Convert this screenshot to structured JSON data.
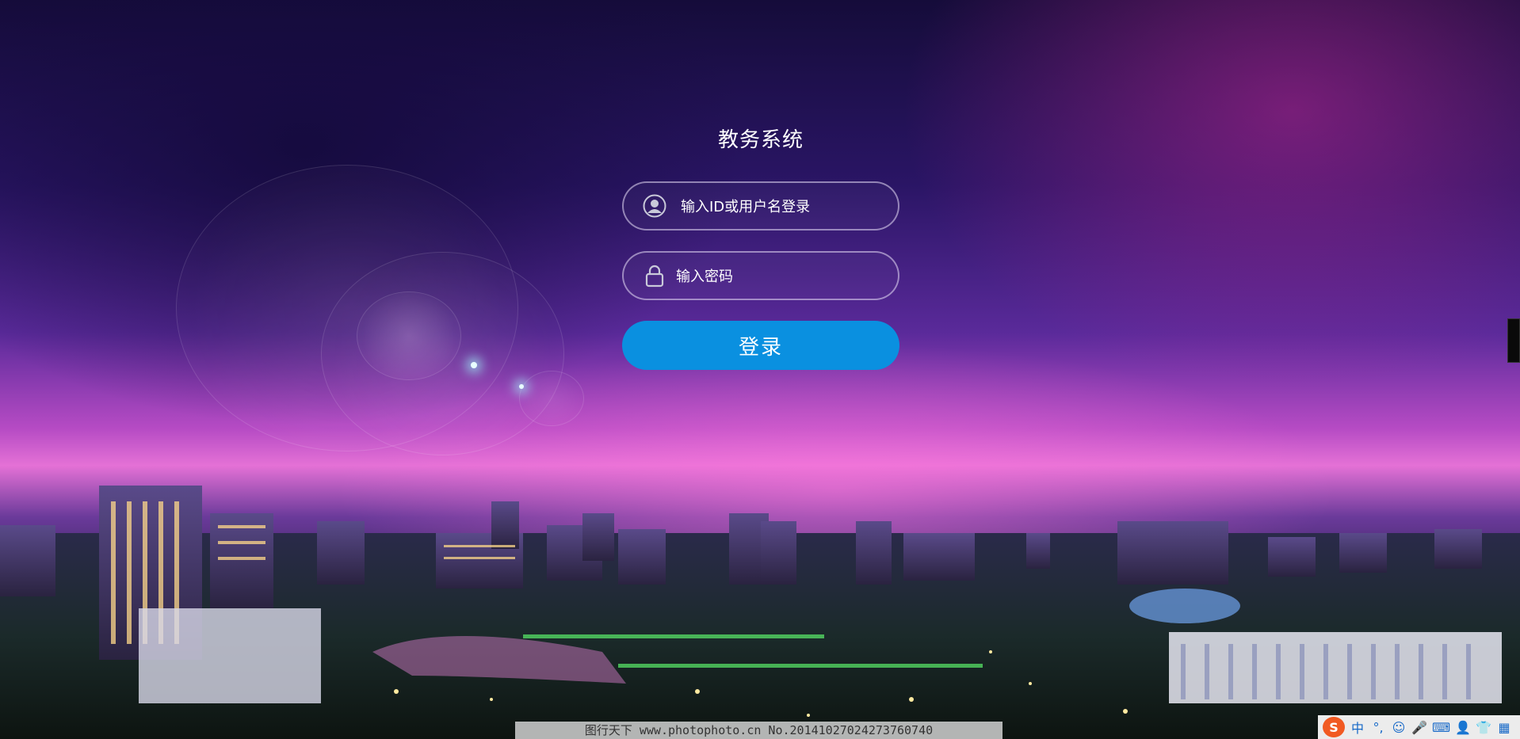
{
  "login": {
    "title": "教务系统",
    "username_placeholder": "输入ID或用户名登录",
    "password_placeholder": "输入密码",
    "submit_label": "登录"
  },
  "watermark": {
    "text": "图行天下 www.photophoto.cn  No.20141027024273760740"
  },
  "ime_toolbar": {
    "logo": "S",
    "mode": "中",
    "punctuation": "°,",
    "icons": [
      "emoji-icon",
      "microphone-icon",
      "keyboard-icon",
      "user-icon",
      "skin-icon",
      "grid-icon"
    ]
  },
  "colors": {
    "button": "#0a90e0",
    "field_border": "#e6dcf5",
    "text": "#ffffff"
  }
}
